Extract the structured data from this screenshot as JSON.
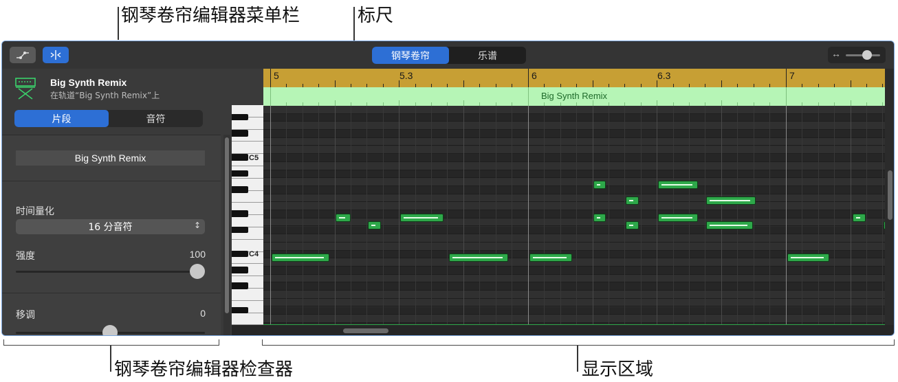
{
  "annotations": {
    "menubar": "钢琴卷帘编辑器菜单栏",
    "ruler": "标尺",
    "inspector": "钢琴卷帘编辑器检查器",
    "display_area": "显示区域"
  },
  "toolbar": {
    "view_tabs": [
      "钢琴卷帘",
      "乐谱"
    ],
    "selected_view": "钢琴卷帘",
    "zoom_icon": "↔"
  },
  "inspector": {
    "region_name": "Big Synth Remix",
    "region_track": "在轨道“Big Synth Remix”上",
    "tabs": [
      "片段",
      "音符"
    ],
    "selected_tab": "片段",
    "name_field": "Big Synth Remix",
    "time_quantize_label": "时间量化",
    "time_quantize_value": "16 分音符",
    "velocity_label": "强度",
    "velocity_value": "100",
    "transpose_label": "移调",
    "transpose_value": "0"
  },
  "editor": {
    "ruler_labels": [
      "5",
      "5.3",
      "6",
      "6.3",
      "7"
    ],
    "region_label": "Big Synth Remix",
    "key_labels": [
      "C5",
      "C4"
    ]
  },
  "colors": {
    "accent": "#2d6fd5",
    "ruler": "#c79f34",
    "region_band": "#b6f5b6",
    "note": "#2ea84a"
  }
}
